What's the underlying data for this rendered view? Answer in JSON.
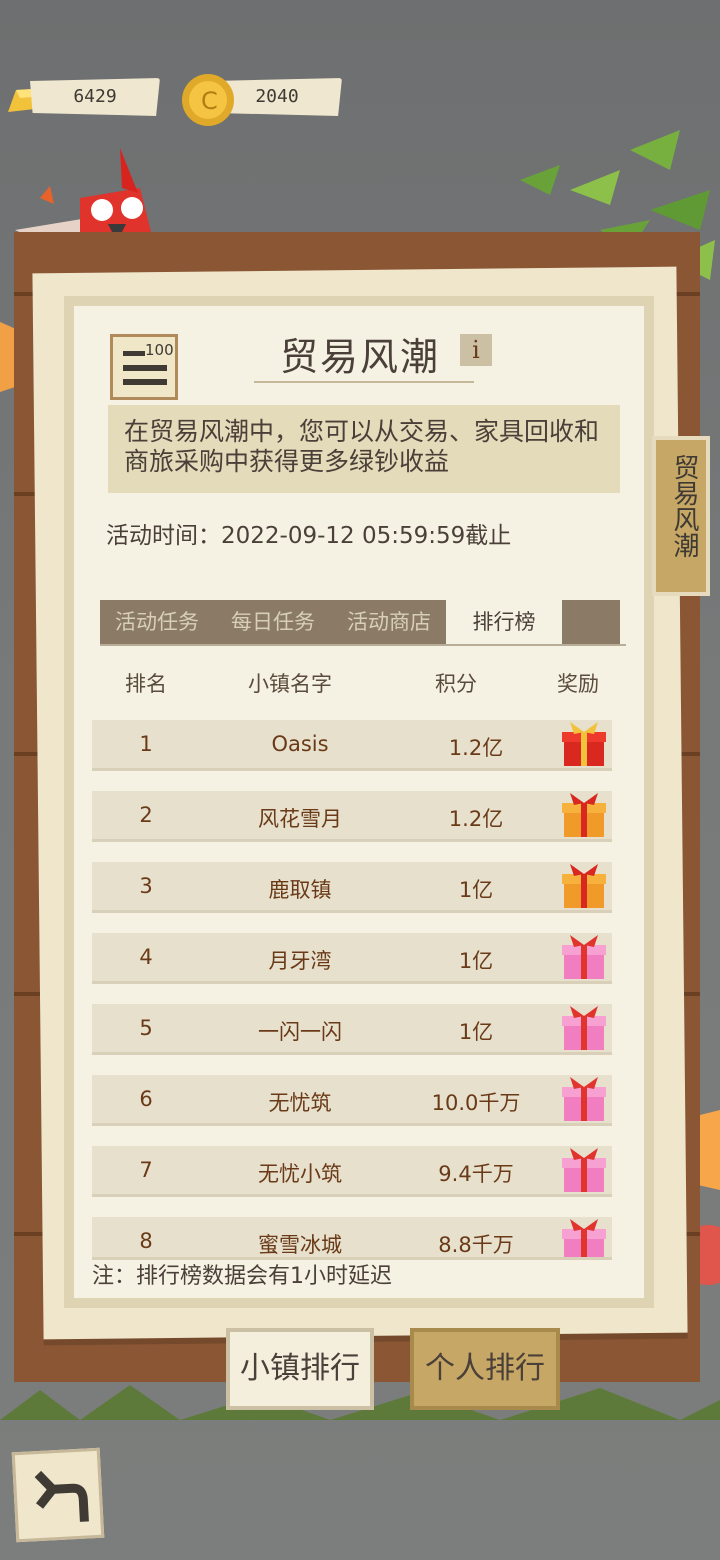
{
  "currency": {
    "gold_amount": "6429",
    "coin_amount": "2040"
  },
  "event": {
    "title": "贸易风潮",
    "badge_text": "100",
    "description": "在贸易风潮中，您可以从交易、家具回收和商旅采购中获得更多绿钞收益",
    "time_text": "活动时间：2022-09-12 05:59:59截止",
    "side_tab": "贸易风潮"
  },
  "tabs": [
    "活动任务",
    "每日任务",
    "活动商店",
    "排行榜"
  ],
  "active_tab": "排行榜",
  "table": {
    "headers": [
      "排名",
      "小镇名字",
      "积分",
      "奖励"
    ],
    "rows": [
      {
        "rank": "1",
        "name": "Oasis",
        "score": "1.2亿",
        "reward": "red-gift-icon"
      },
      {
        "rank": "2",
        "name": "风花雪月",
        "score": "1.2亿",
        "reward": "orange-gift-icon"
      },
      {
        "rank": "3",
        "name": "鹿取镇",
        "score": "1亿",
        "reward": "orange-gift-icon"
      },
      {
        "rank": "4",
        "name": "月牙湾",
        "score": "1亿",
        "reward": "pink-gift-icon"
      },
      {
        "rank": "5",
        "name": "一闪一闪",
        "score": "1亿",
        "reward": "pink-gift-icon"
      },
      {
        "rank": "6",
        "name": "无忧筑",
        "score": "10.0千万",
        "reward": "pink-gift-icon"
      },
      {
        "rank": "7",
        "name": "无忧小筑",
        "score": "9.4千万",
        "reward": "pink-gift-icon"
      },
      {
        "rank": "8",
        "name": "蜜雪冰城",
        "score": "8.8千万",
        "reward": "pink-gift-icon"
      }
    ]
  },
  "note": "注：排行榜数据会有1小时延迟",
  "buttons": {
    "town_rank": "小镇排行",
    "personal_rank": "个人排行"
  },
  "colors": {
    "board": "#8a5634",
    "paper": "#f6f2e3",
    "tab_bar": "#8a7a66",
    "text_brown": "#6a3a18",
    "button_gold": "#c7a765"
  }
}
